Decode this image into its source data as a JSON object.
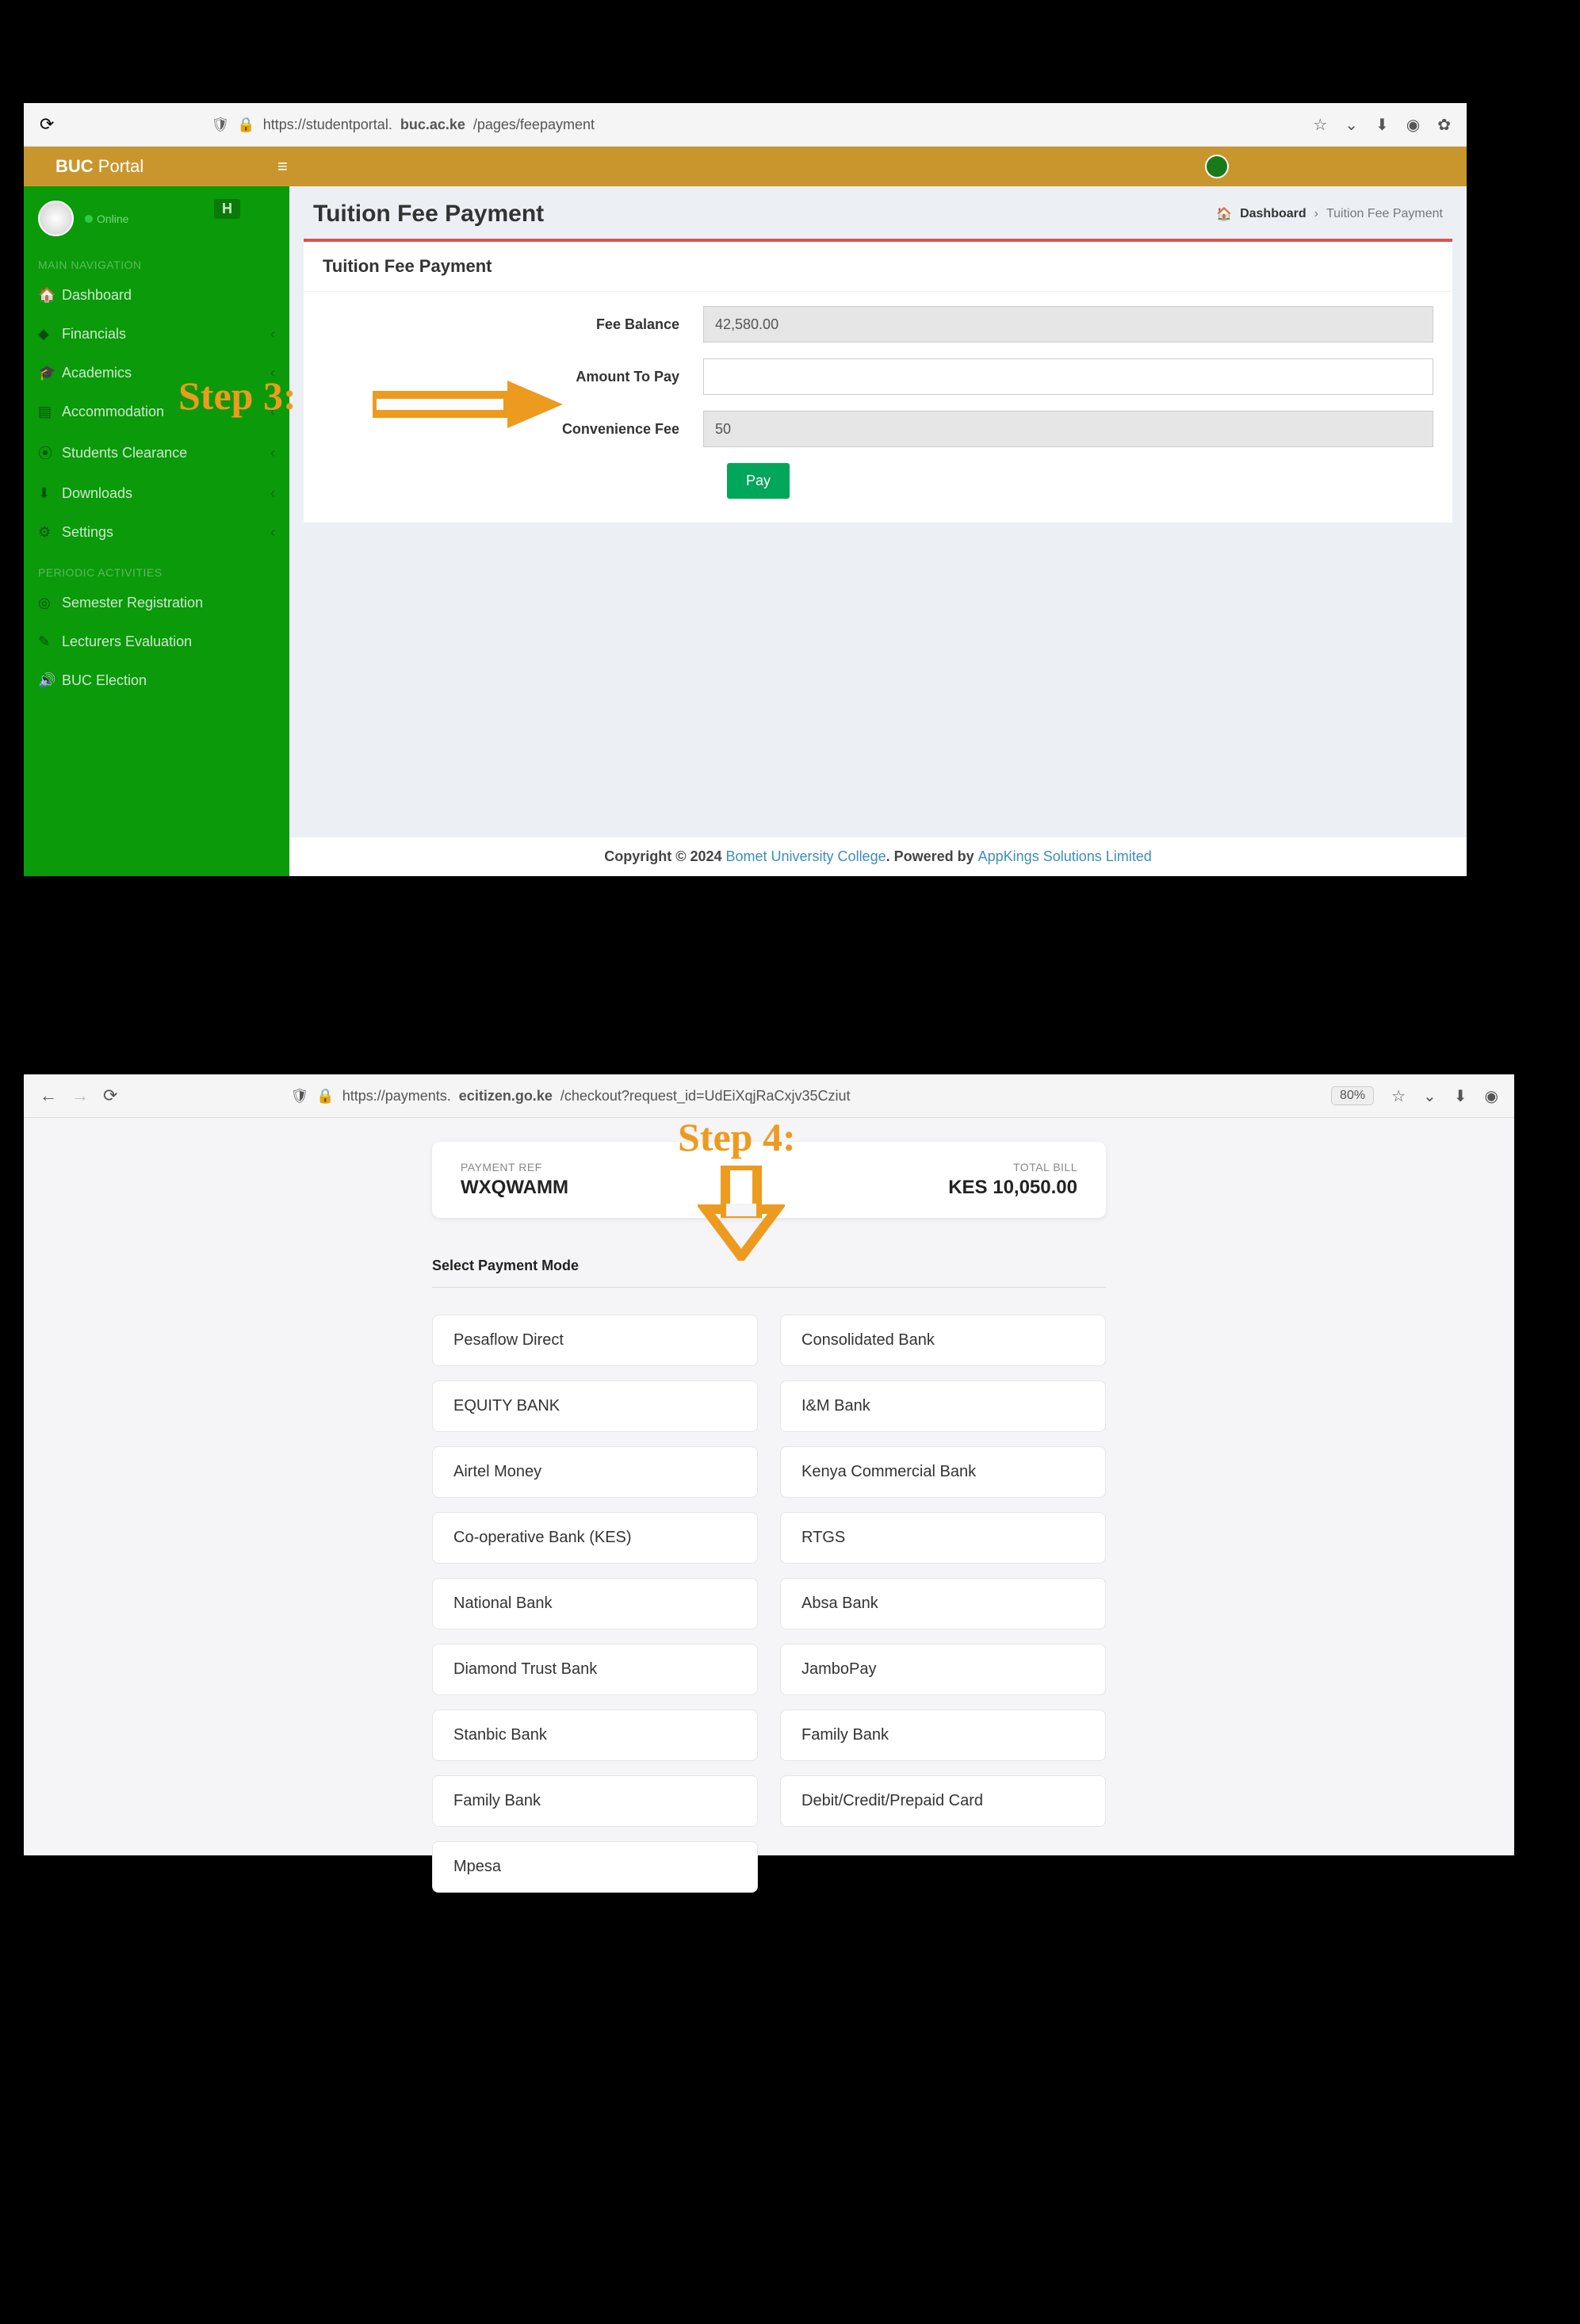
{
  "annotations": {
    "step3": "Step 3:",
    "step4": "Step 4:"
  },
  "shot1": {
    "browser": {
      "url_prefix": "https://studentportal.",
      "url_bold": "buc.ac.ke",
      "url_suffix": "/pages/feepayment"
    },
    "topbar": {
      "brand_bold": "BUC",
      "brand_light": "Portal"
    },
    "sidebar": {
      "online": "Online",
      "initial": "H",
      "section1": "MAIN NAVIGATION",
      "items1": [
        {
          "label": "Dashboard",
          "chevron": false
        },
        {
          "label": "Financials",
          "chevron": true
        },
        {
          "label": "Academics",
          "chevron": true
        },
        {
          "label": "Accommodation",
          "chevron": true
        },
        {
          "label": "Students Clearance",
          "chevron": true
        },
        {
          "label": "Downloads",
          "chevron": true
        },
        {
          "label": "Settings",
          "chevron": true
        }
      ],
      "section2": "PERIODIC ACTIVITIES",
      "items2": [
        {
          "label": "Semester Registration"
        },
        {
          "label": "Lecturers Evaluation"
        },
        {
          "label": "BUC Election"
        }
      ]
    },
    "main": {
      "title": "Tuition Fee Payment",
      "breadcrumb_dash": "Dashboard",
      "breadcrumb_current": "Tuition Fee Payment",
      "card_title": "Tuition Fee Payment",
      "form": {
        "fee_balance_label": "Fee Balance",
        "fee_balance_value": "42,580.00",
        "amount_label": "Amount To Pay",
        "amount_value": "",
        "conv_label": "Convenience Fee",
        "conv_value": "50",
        "pay_label": "Pay"
      },
      "footer": {
        "copy": "Copyright © 2024 ",
        "link1": "Bomet University College",
        "mid": ". Powered by ",
        "link2": "AppKings Solutions Limited"
      }
    }
  },
  "shot2": {
    "browser": {
      "url_prefix": "https://payments.",
      "url_bold": "ecitizen.go.ke",
      "url_suffix": "/checkout?request_id=UdEiXqjRaCxjv35Cziut",
      "zoom": "80%"
    },
    "ref": {
      "ref_lbl": "PAYMENT REF",
      "ref_val": "WXQWAMM",
      "total_lbl": "TOTAL BILL",
      "total_val": "KES 10,050.00"
    },
    "section_label": "Select Payment Mode",
    "options_left": [
      "Pesaflow Direct",
      "EQUITY BANK",
      "Airtel Money",
      "Co-operative Bank (KES)",
      "National Bank",
      "Diamond Trust Bank",
      "Stanbic Bank",
      "Family Bank",
      "Mpesa"
    ],
    "options_right": [
      "Consolidated Bank",
      "I&M Bank",
      "Kenya Commercial Bank",
      "RTGS",
      "Absa Bank",
      "JamboPay",
      "Family Bank",
      "Debit/Credit/Prepaid Card"
    ]
  }
}
